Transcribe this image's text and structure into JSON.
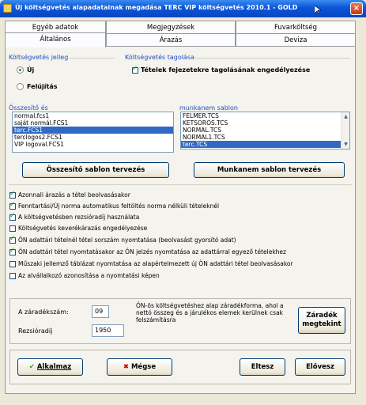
{
  "window": {
    "title": "Új költségvetés alapadatainak megadása   TERC VIP költségvetés 2010.1 - GOLD",
    "close_glyph": "×"
  },
  "tabs_top": [
    "Egyéb adatok",
    "Megjegyzések",
    "Fuvarköltség"
  ],
  "tabs_bottom": [
    "Általános",
    "Árazás",
    "Deviza"
  ],
  "jelleg": {
    "title": "Költségvetés jelleg",
    "options": [
      "Új",
      "Felújítás"
    ],
    "selected": 0
  },
  "tagolas": {
    "title": "Költségvetés tagolása",
    "checkbox_label": "Tételek fejezetekre tagolásának engedélyezése",
    "checked": true
  },
  "osszesito": {
    "label": "Összesítő és",
    "items": [
      "normal.fcs1",
      "saját normál.FCS1",
      "terc.FCS1",
      "terclogos2.FCS1",
      "VIP logoval.FCS1"
    ],
    "selected": 2,
    "button": "Összesítő sablon tervezés"
  },
  "munkanem": {
    "label": "munkanem sablon",
    "items": [
      "FELMER.TCS",
      "KETSOROS.TCS",
      "NORMAL.TCS",
      "NORMAL1.TCS",
      "terc.TCS"
    ],
    "selected": 4,
    "button": "Munkanem sablon tervezés"
  },
  "options": [
    {
      "label": "Azonnali árazás a tétel beolvasásakor",
      "checked": true
    },
    {
      "label": "Fenntartási/Új norma automatikus feltöltés norma nélküli tételeknél",
      "checked": true
    },
    {
      "label": "A költségvetésben rezsióradíj használata",
      "checked": true
    },
    {
      "label": "Költségvetés keverékárazás engedélyezése",
      "checked": false
    },
    {
      "label": "ÖN adattári tételnél tétel sorszám nyomtatása (beolvasást gyorsító adat)",
      "checked": true
    },
    {
      "label": "ÖN adattári tétel nyomtatásakor az ÖN jelzés nyomtatása az adattárral egyező tételekhez",
      "checked": true
    },
    {
      "label": "Műszaki jellemző táblázat nyomtatása az alapértelmezett új ÖN adattári tétel beolvasásakor",
      "checked": false
    },
    {
      "label": "Az alvállalkozó azonosítása a nyomtatási képen",
      "checked": false
    }
  ],
  "zaradek": {
    "szam_label": "A záradékszám:",
    "szam_value": "09",
    "rezsi_label": "Rezsióradíj",
    "rezsi_value": "1950",
    "info": "ÖN-ös költségvetéshez alap záradékforma, ahol a nettó összeg és a járulékos elemek kerülnek csak felszámításra",
    "button": "Záradék megtekint"
  },
  "footer": {
    "apply": "Alkalmaz",
    "cancel": "Mégse",
    "prev": "Eltesz",
    "preview": "Elővesz"
  },
  "colors": {
    "title_bar": "#0a55d8",
    "group_title": "#1f4fc2",
    "selection": "#316ac5",
    "check": "#21a121",
    "cancel_x": "#cc0000"
  }
}
